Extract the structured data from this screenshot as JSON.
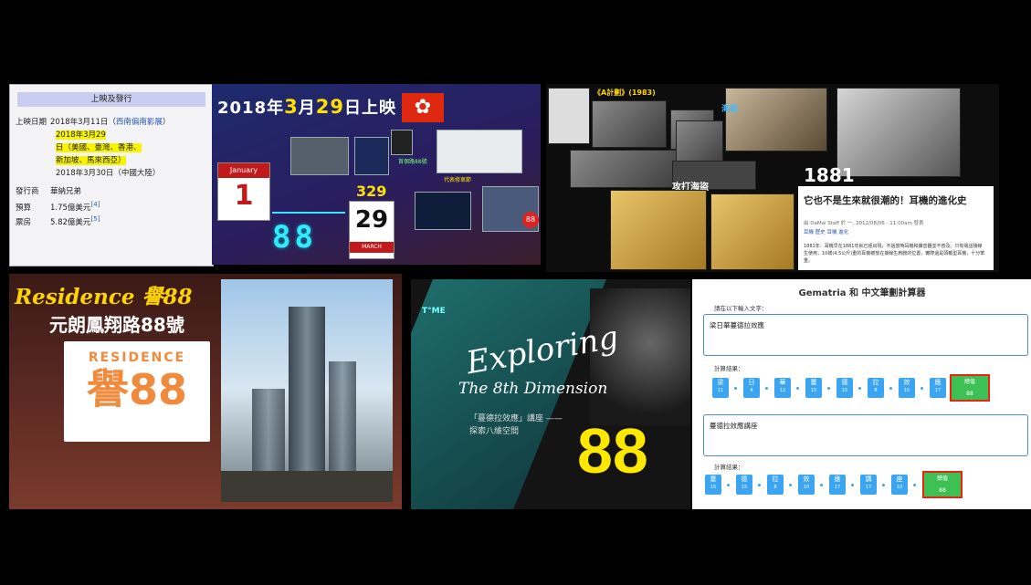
{
  "wiki_box": {
    "header": "上映及發行",
    "release_label": "上映日期",
    "release_1": "2018年3月11日（",
    "release_1_link": "西南偏南影展",
    "release_1_end": "）",
    "release_2a": "2018年3月29",
    "release_2b": "日（美國、臺灣、香港、",
    "release_2c": "新加坡、馬來西亞）",
    "release_3": "2018年3月30日（中國大陸）",
    "distributor_label": "發行商",
    "distributor": "華納兄弟",
    "budget_label": "預算",
    "budget": "1.75億美元",
    "budget_ref": "[4]",
    "boxoffice_label": "票房",
    "boxoffice": "5.82億美元",
    "boxoffice_ref": "[5]"
  },
  "release_panel": {
    "title_a": "2018年",
    "title_b": "3",
    "title_c": "月",
    "title_d": "29",
    "title_e": "日上映",
    "calendar_month": "January",
    "calendar_day": "1",
    "big_number": "88",
    "label_329": "329",
    "calendar2_day": "29",
    "calendar2_month": "MARCH",
    "caption_1": "代表修車節",
    "caption_2": "88",
    "caption_3": "首個路88號"
  },
  "collage": {
    "label_a": "《A計劃》(1983)",
    "label_b": "海盜",
    "label_c": "攻打海盜",
    "year": "1881",
    "card_title": "它也不是生來就很潮的！耳機的進化史",
    "card_meta": "由 DaMai Staff 於 一, 2012/08/06 - 11:00am 發表",
    "card_tags": "耳機 歷史 耳機 進化",
    "card_text": "1881年：耳機早在1881年就已經出現，不過當時耳機和擴音器並不普及。只有電話接線生使用，10磅(4.5公斤)重的耳機被放在接線生肩膀的位置，實際還是頭戴型耳機，十分笨重。"
  },
  "residence": {
    "title": "Residence 譽88",
    "address": "元朗鳳翔路88號",
    "logo_text": "RESIDENCE",
    "logo_glyph": "譽88"
  },
  "exploring": {
    "brand": "T°ME",
    "title": "Exploring",
    "subtitle": "The 8th Dimension",
    "lecture_1": "「蔓德拉效應」講座 ——",
    "lecture_2": "探索八維空間",
    "big_number": "88"
  },
  "gematria": {
    "header": "Gematria 和 中文筆劃計算器",
    "prompt": "請在以下輸入文字：",
    "input_1": "梁日華蔓德拉效應",
    "result_label": "計算結果：",
    "chips_1": [
      {
        "c": "梁",
        "n": "11"
      },
      {
        "c": "日",
        "n": "4"
      },
      {
        "c": "華",
        "n": "12"
      },
      {
        "c": "蔓",
        "n": "15"
      },
      {
        "c": "德",
        "n": "15"
      },
      {
        "c": "拉",
        "n": "8"
      },
      {
        "c": "效",
        "n": "10"
      },
      {
        "c": "應",
        "n": "17"
      }
    ],
    "total_label": "總值",
    "total_1": "88",
    "input_2": "蔓德拉效應講座",
    "chips_2": [
      {
        "c": "蔓",
        "n": "15"
      },
      {
        "c": "德",
        "n": "15"
      },
      {
        "c": "拉",
        "n": "8"
      },
      {
        "c": "效",
        "n": "10"
      },
      {
        "c": "應",
        "n": "17"
      },
      {
        "c": "講",
        "n": "17"
      },
      {
        "c": "座",
        "n": "10"
      }
    ],
    "total_2": "88"
  }
}
